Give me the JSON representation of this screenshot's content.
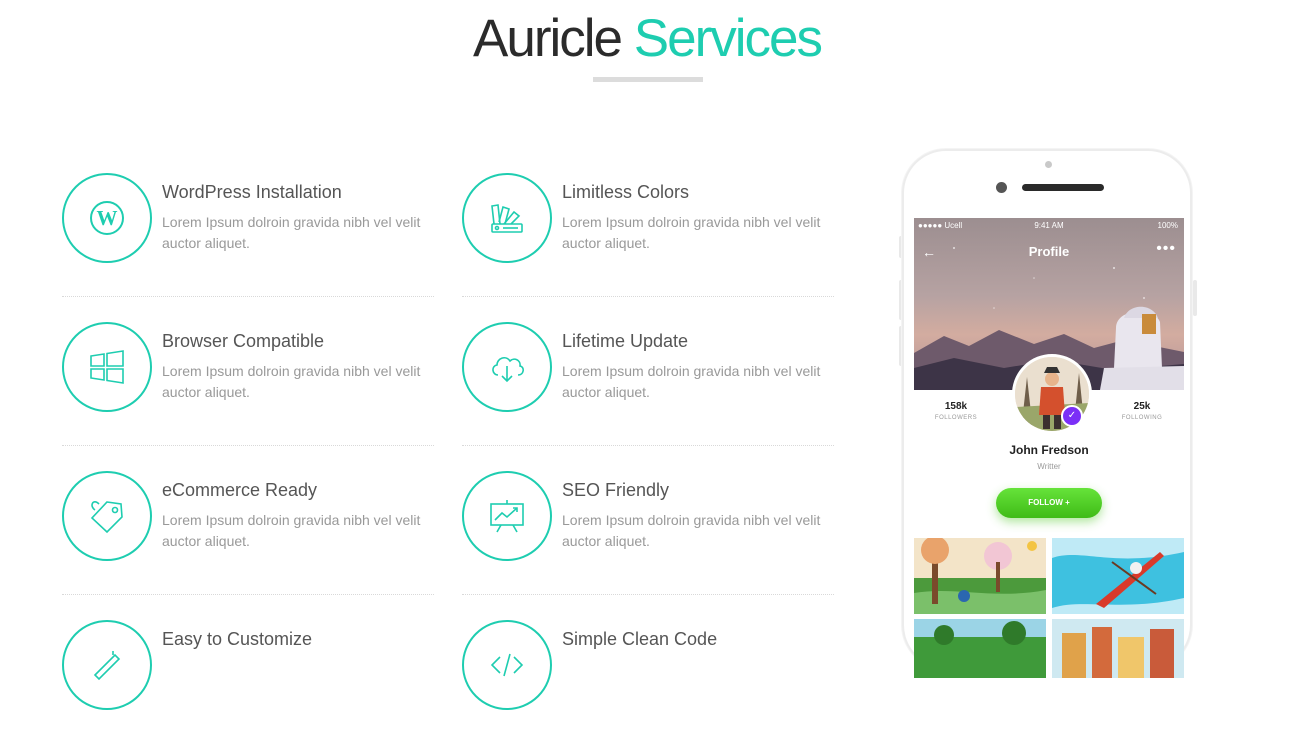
{
  "header": {
    "title_word1": "Auricle",
    "title_word2": "Services",
    "accent_color": "#1ecdb0"
  },
  "features": [
    {
      "title": "WordPress Installation",
      "description": "Lorem Ipsum dolroin gravida nibh vel velit auctor aliquet.",
      "icon": "wordpress-icon"
    },
    {
      "title": "Limitless Colors",
      "description": "Lorem Ipsum dolroin gravida nibh vel velit auctor aliquet.",
      "icon": "color-swatch-icon"
    },
    {
      "title": "Browser Compatible",
      "description": "Lorem Ipsum dolroin gravida nibh vel velit auctor aliquet.",
      "icon": "windows-icon"
    },
    {
      "title": "Lifetime Update",
      "description": "Lorem Ipsum dolroin gravida nibh vel velit auctor aliquet.",
      "icon": "cloud-download-icon"
    },
    {
      "title": "eCommerce Ready",
      "description": "Lorem Ipsum dolroin gravida nibh vel velit auctor aliquet.",
      "icon": "price-tag-icon"
    },
    {
      "title": "SEO Friendly",
      "description": "Lorem Ipsum dolroin gravida nibh vel velit auctor aliquet.",
      "icon": "presentation-chart-icon"
    },
    {
      "title": "Easy to Customize",
      "description": "",
      "icon": "customize-icon"
    },
    {
      "title": "Simple Clean Code",
      "description": "",
      "icon": "code-icon"
    }
  ],
  "phone": {
    "status_carrier": "●●●●● Ucell",
    "status_time": "9:41 AM",
    "status_battery": "100%",
    "screen_title": "Profile",
    "back_symbol": "←",
    "more_symbol": "•••",
    "followers_count": "158k",
    "followers_label": "FOLLOWERS",
    "following_count": "25k",
    "following_label": "FOLLOWING",
    "name": "John Fredson",
    "role": "Writter",
    "follow_button": "FOLLOW  +",
    "button_color": "#4ccd22",
    "verify_color": "#7b2ff7"
  }
}
